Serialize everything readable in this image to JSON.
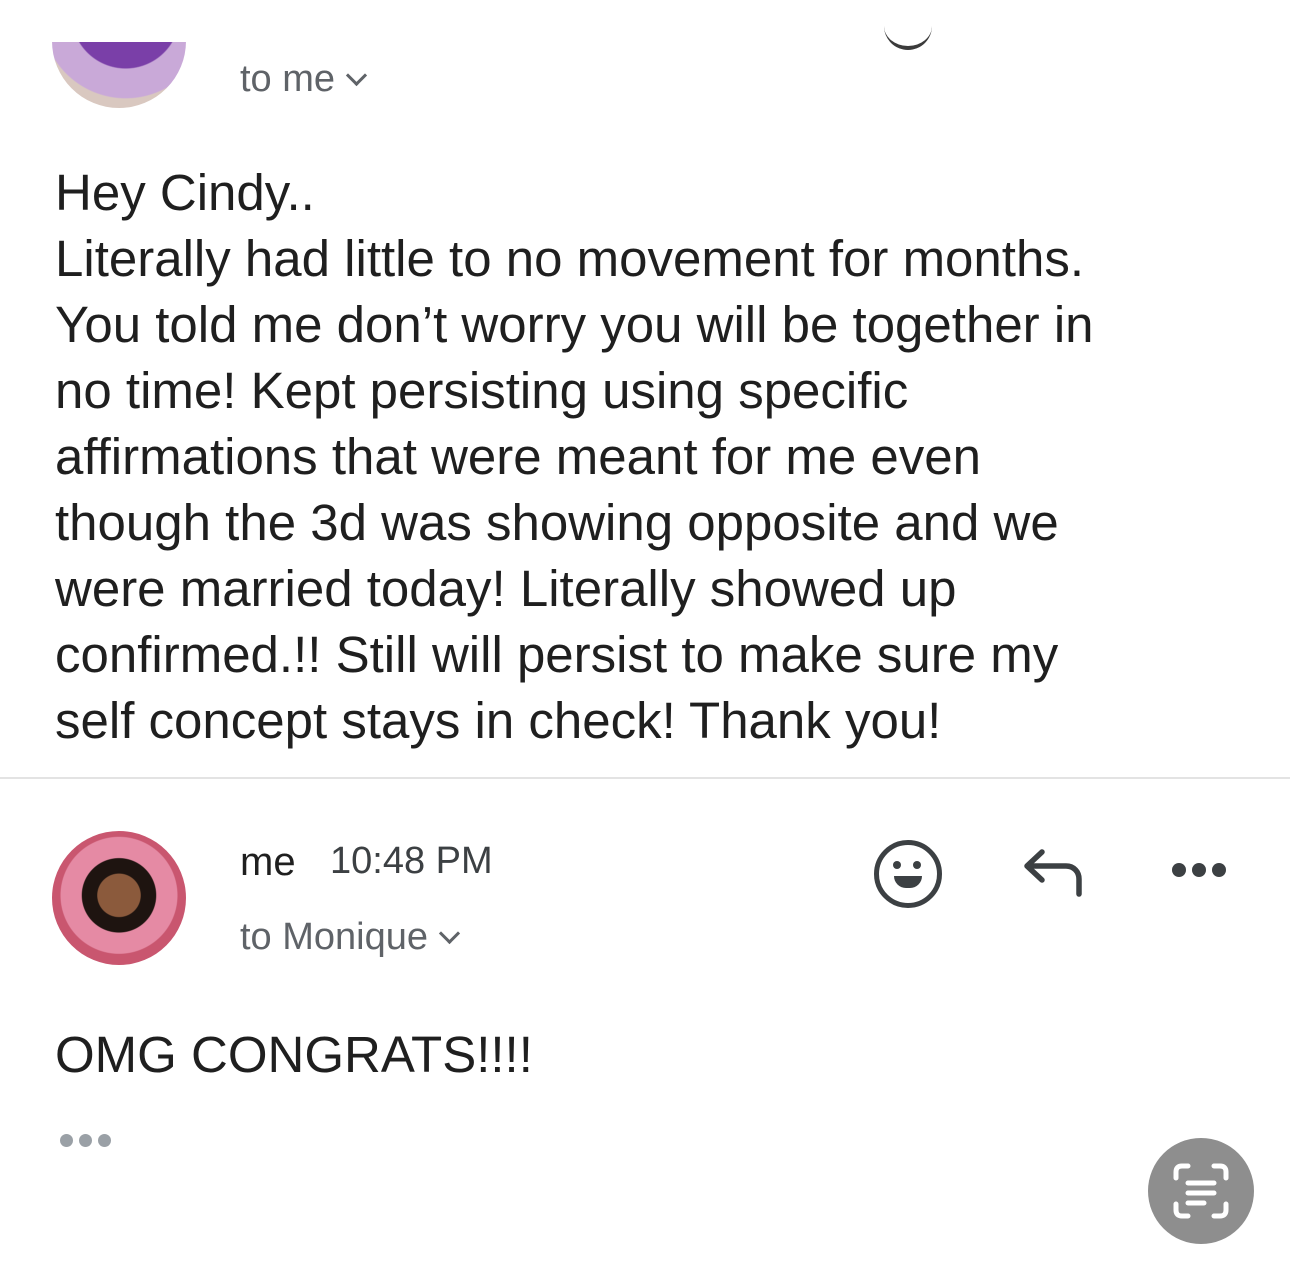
{
  "sender_message": {
    "recipient_line": "to me",
    "body_lines": [
      "Hey Cindy..",
      "Literally had little to no movement for months.",
      "You told me don’t worry you will be together in",
      "no time! Kept persisting using specific",
      "affirmations that were meant for me even",
      "though the 3d was showing opposite and we",
      "were married today!   Literally showed up",
      "confirmed.!! Still will persist to make sure my",
      "self concept stays in check! Thank you!"
    ]
  },
  "reply_message": {
    "sender": "me",
    "time": "10:48 PM",
    "recipient_line": "to Monique",
    "body": "OMG CONGRATS!!!!"
  },
  "icons": {
    "emoji": "emoji-reaction-icon",
    "reply": "reply-arrow-icon",
    "more": "more-horizontal-icon",
    "trimmed": "show-trimmed-content-icon",
    "live_text": "live-text-scan-icon"
  }
}
